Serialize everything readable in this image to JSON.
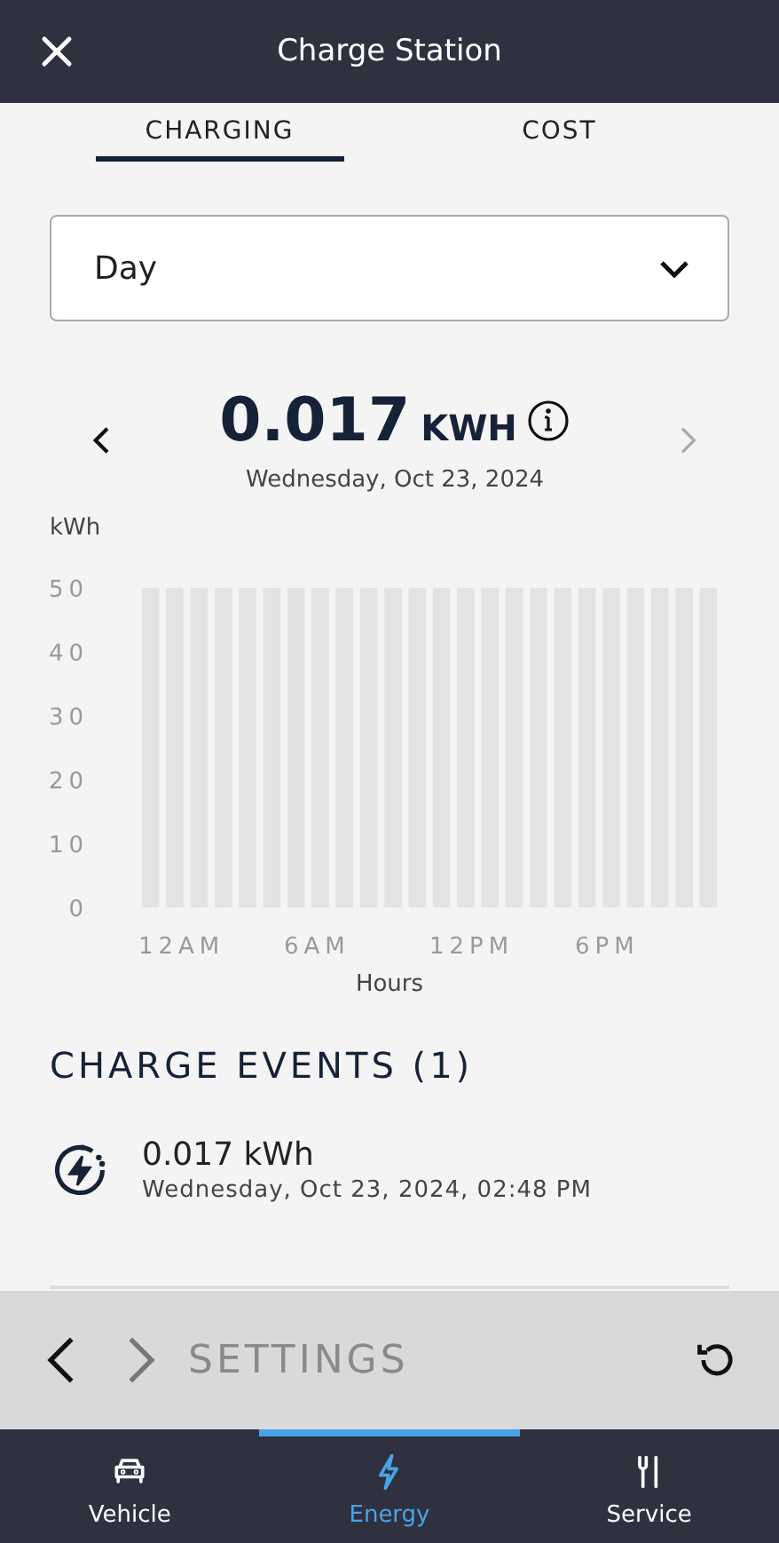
{
  "header": {
    "title": "Charge Station"
  },
  "tabs": [
    {
      "label": "CHARGING",
      "selected": true
    },
    {
      "label": "COST",
      "selected": false
    }
  ],
  "period_select": {
    "value": "Day"
  },
  "summary": {
    "value": "0.017",
    "unit": "KWH",
    "date": "Wednesday, Oct 23, 2024"
  },
  "chart": {
    "unit_label": "kWh",
    "y_labels": [
      "50",
      "40",
      "30",
      "20",
      "10",
      "0"
    ],
    "x_labels": [
      "12AM",
      "6AM",
      "12PM",
      "6PM"
    ],
    "x_title": "Hours"
  },
  "charge_events": {
    "title": "CHARGE EVENTS (1)",
    "items": [
      {
        "energy": "0.017 kWh",
        "time": "Wednesday, Oct 23, 2024, 02:48 PM"
      }
    ]
  },
  "settings_heading": "SETTINGS",
  "bottom_nav": [
    {
      "label": "Vehicle",
      "selected": false
    },
    {
      "label": "Energy",
      "selected": true
    },
    {
      "label": "Service",
      "selected": false
    }
  ]
}
